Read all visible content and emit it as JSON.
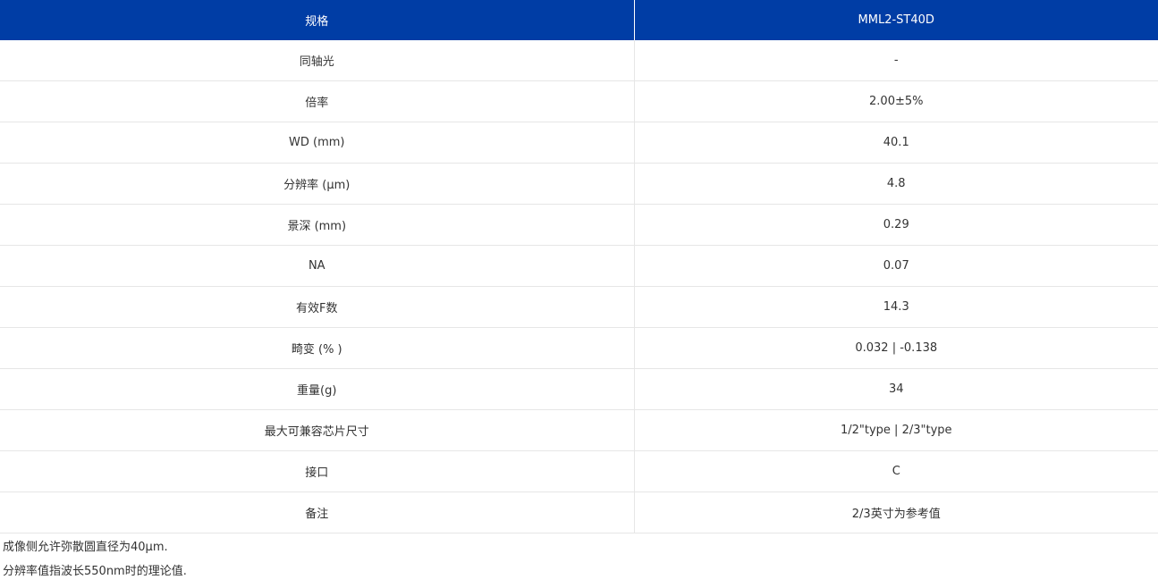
{
  "header": {
    "col1": "规格",
    "col2": "MML2-ST40D"
  },
  "rows": [
    {
      "label": "同轴光",
      "value": "-"
    },
    {
      "label": "倍率",
      "value": "2.00±5%"
    },
    {
      "label": "WD (mm)",
      "value": "40.1"
    },
    {
      "label": "分辨率 (µm)",
      "value": "4.8"
    },
    {
      "label": "景深 (mm)",
      "value": "0.29"
    },
    {
      "label": "NA",
      "value": "0.07"
    },
    {
      "label": "有效F数",
      "value": "14.3"
    },
    {
      "label": "畸变 (% )",
      "value": "0.032 | -0.138"
    },
    {
      "label": "重量(g)",
      "value": "34"
    },
    {
      "label": "最大可兼容芯片尺寸",
      "value": "1/2\"type | 2/3\"type"
    },
    {
      "label": "接口",
      "value": "C"
    },
    {
      "label": "备注",
      "value": "2/3英寸为参考值"
    }
  ],
  "notes": [
    "成像侧允许弥散圆直径为40µm.",
    "分辨率值指波长550nm时的理论值."
  ],
  "colors": {
    "header_bg": "#003da5",
    "header_text": "#ffffff",
    "border": "#e6e6e6",
    "text": "#333333"
  }
}
